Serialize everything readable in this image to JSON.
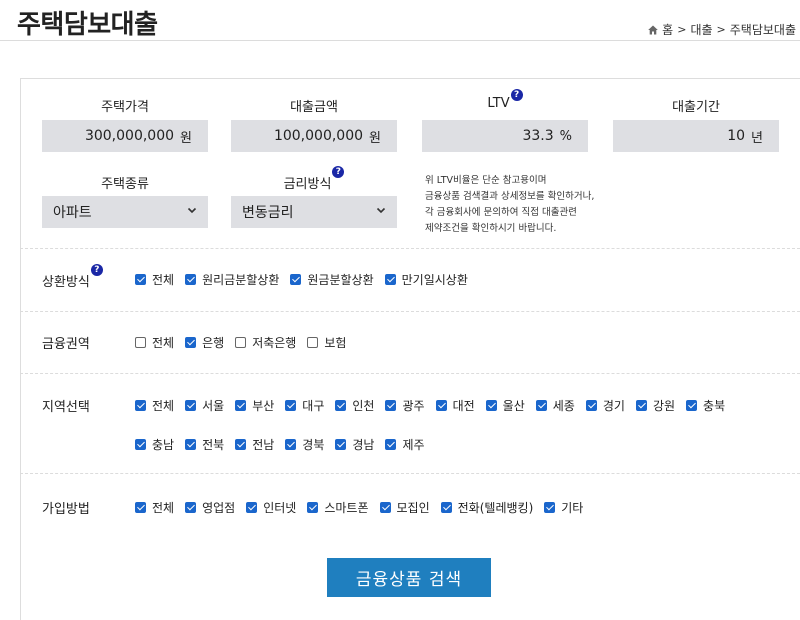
{
  "page": {
    "title": "주택담보대출"
  },
  "breadcrumb": {
    "home": "홈",
    "sep": ">",
    "section": "대출",
    "current": "주택담보대출"
  },
  "fields": {
    "house_price": {
      "label": "주택가격",
      "value": "300,000,000",
      "unit": "원"
    },
    "loan_amount": {
      "label": "대출금액",
      "value": "100,000,000",
      "unit": "원"
    },
    "ltv": {
      "label": "LTV",
      "value": "33.3",
      "unit": "%"
    },
    "loan_period": {
      "label": "대출기간",
      "value": "10",
      "unit": "년"
    },
    "house_type": {
      "label": "주택종류",
      "value": "아파트"
    },
    "rate_type": {
      "label": "금리방식",
      "value": "변동금리"
    }
  },
  "help_icon": "?",
  "note_lines": [
    "위 LTV비율은 단순 참고용이며",
    "금융상품 검색결과 상세정보를 확인하거나,",
    "각 금융회사에 문의하여 직접 대출관련",
    "제약조건을 확인하시기 바랍니다."
  ],
  "repayment": {
    "label": "상환방식",
    "options": [
      {
        "label": "전체",
        "checked": true
      },
      {
        "label": "원리금분할상환",
        "checked": true
      },
      {
        "label": "원금분할상환",
        "checked": true
      },
      {
        "label": "만기일시상환",
        "checked": true
      }
    ]
  },
  "sector": {
    "label": "금융권역",
    "options": [
      {
        "label": "전체",
        "checked": false
      },
      {
        "label": "은행",
        "checked": true
      },
      {
        "label": "저축은행",
        "checked": false
      },
      {
        "label": "보험",
        "checked": false
      }
    ]
  },
  "region": {
    "label": "지역선택",
    "options": [
      {
        "label": "전체",
        "checked": true
      },
      {
        "label": "서울",
        "checked": true
      },
      {
        "label": "부산",
        "checked": true
      },
      {
        "label": "대구",
        "checked": true
      },
      {
        "label": "인천",
        "checked": true
      },
      {
        "label": "광주",
        "checked": true
      },
      {
        "label": "대전",
        "checked": true
      },
      {
        "label": "울산",
        "checked": true
      },
      {
        "label": "세종",
        "checked": true
      },
      {
        "label": "경기",
        "checked": true
      },
      {
        "label": "강원",
        "checked": true
      },
      {
        "label": "충북",
        "checked": true
      },
      {
        "label": "충남",
        "checked": true
      },
      {
        "label": "전북",
        "checked": true
      },
      {
        "label": "전남",
        "checked": true
      },
      {
        "label": "경북",
        "checked": true
      },
      {
        "label": "경남",
        "checked": true
      },
      {
        "label": "제주",
        "checked": true
      }
    ]
  },
  "join_method": {
    "label": "가입방법",
    "options": [
      {
        "label": "전체",
        "checked": true
      },
      {
        "label": "영업점",
        "checked": true
      },
      {
        "label": "인터넷",
        "checked": true
      },
      {
        "label": "스마트폰",
        "checked": true
      },
      {
        "label": "모집인",
        "checked": true
      },
      {
        "label": "전화(텔레뱅킹)",
        "checked": true
      },
      {
        "label": "기타",
        "checked": true
      }
    ]
  },
  "search_button": "금융상품 검색",
  "colors": {
    "accent": "#1f7fbf",
    "checkbox": "#1a66cc",
    "help": "#1a27a6",
    "field_bg": "#dedfe3"
  }
}
